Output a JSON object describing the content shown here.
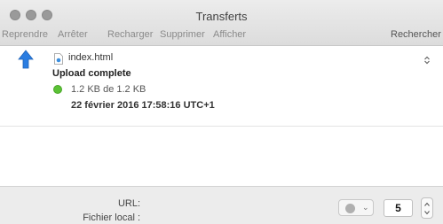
{
  "window": {
    "title": "Transferts"
  },
  "toolbar": {
    "reprendre": "Reprendre",
    "arreter": "Arrêter",
    "recharger": "Recharger",
    "supprimer": "Supprimer",
    "afficher": "Afficher",
    "rechercher": "Rechercher"
  },
  "transfers": [
    {
      "filename": "index.html",
      "status": "Upload complete",
      "size": "1.2 KB de 1.2 KB",
      "date": "22 février 2016 17:58:16 UTC+1",
      "status_color": "#5bc236",
      "direction_icon": "upload-arrow-icon"
    }
  ],
  "footer": {
    "url_label": "URL:",
    "local_file_label": "Fichier local :",
    "connections_value": "5"
  },
  "colors": {
    "arrow_blue": "#2a7de1",
    "titlebar": "#e2e2e2"
  }
}
